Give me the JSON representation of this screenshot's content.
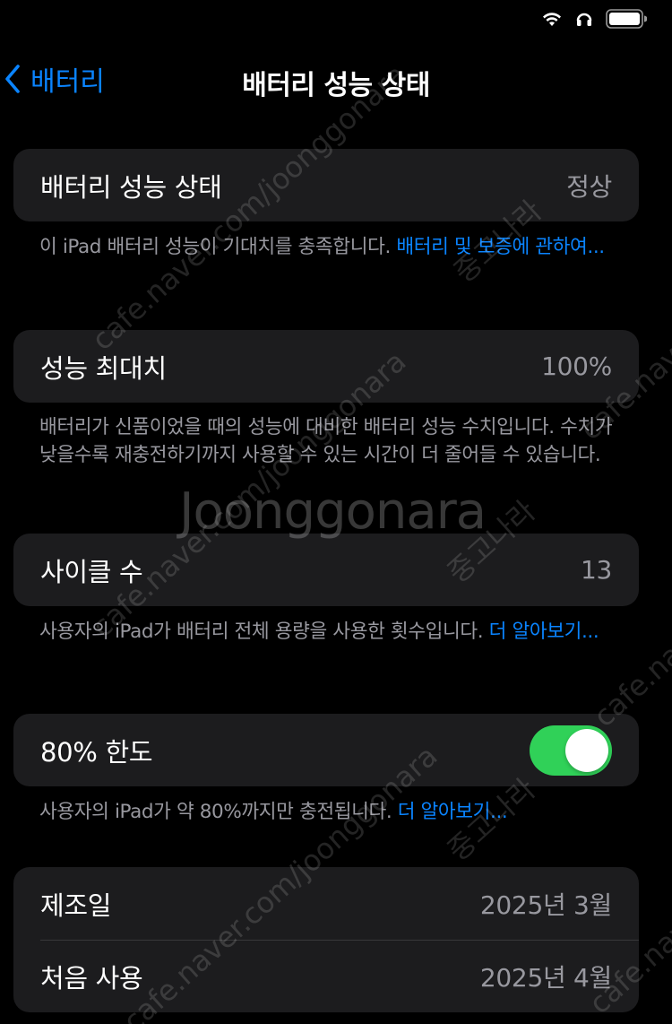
{
  "nav": {
    "back_label": "배터리",
    "title": "배터리 성능 상태"
  },
  "health": {
    "label": "배터리 성능 상태",
    "value": "정상",
    "footer_text": "이 iPad 배터리 성능이 기대치를 충족합니다. ",
    "footer_link": "배터리 및 보증에 관하여..."
  },
  "max_capacity": {
    "label": "성능 최대치",
    "value": "100%",
    "footer_text": "배터리가 신품이었을 때의 성능에 대비한 배터리 성능 수치입니다. 수치가 낮을수록 재충전하기까지 사용할 수 있는 시간이 더 줄어들 수 있습니다."
  },
  "cycle_count": {
    "label": "사이클 수",
    "value": "13",
    "footer_text": "사용자의 iPad가 배터리 전체 용량을 사용한 횟수입니다. ",
    "footer_link": "더 알아보기..."
  },
  "limit": {
    "label": "80% 한도",
    "toggle_on": true,
    "footer_text": "사용자의 iPad가 약 80%까지만 충전됩니다. ",
    "footer_link": "더 알아보기..."
  },
  "dates": {
    "manufacture_label": "제조일",
    "manufacture_value": "2025년 3월",
    "first_use_label": "처음 사용",
    "first_use_value": "2025년 4월"
  },
  "watermark": {
    "logo": "Joonggonara",
    "site": "cafe.naver.com/joonggonara",
    "short": "cafe.naver",
    "brand": "중고나라"
  },
  "colors": {
    "background": "#000000",
    "cell": "#1c1c1e",
    "accent": "#0a84ff",
    "toggle_on": "#30d158",
    "secondary_text": "#98989f"
  },
  "icons": {
    "status": [
      "wifi-icon",
      "headphones-icon",
      "battery-icon"
    ],
    "nav": "chevron-left-icon"
  }
}
